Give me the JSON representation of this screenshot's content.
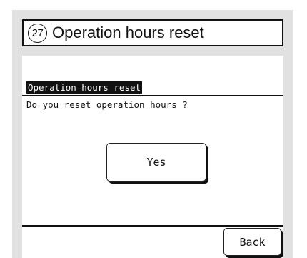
{
  "header": {
    "number": "27",
    "title": "Operation hours reset"
  },
  "screen": {
    "heading": "Operation hours reset",
    "question": "Do you reset operation hours ?",
    "yes_label": "Yes",
    "back_label": "Back"
  },
  "colors": {
    "frame": "#e1e1e1",
    "ink": "#111111",
    "screen_bg": "#ffffff"
  }
}
